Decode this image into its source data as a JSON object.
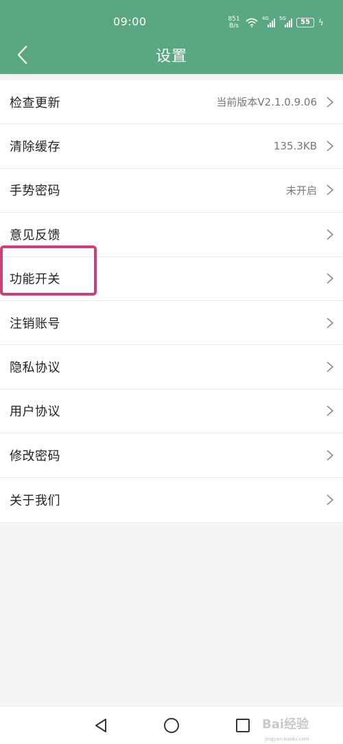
{
  "status_bar": {
    "time": "09:00",
    "speed_value": "851",
    "speed_unit": "B/s",
    "net1": "4G",
    "net2": "5G",
    "battery": "55"
  },
  "header": {
    "title": "设置",
    "back_icon": "chevron-left-icon"
  },
  "settings": [
    {
      "label": "检查更新",
      "value": "当前版本V2.1.0.9.06"
    },
    {
      "label": "清除缓存",
      "value": "135.3KB"
    },
    {
      "label": "手势密码",
      "value": "未开启"
    },
    {
      "label": "意见反馈",
      "value": ""
    },
    {
      "label": "功能开关",
      "value": ""
    },
    {
      "label": "注销账号",
      "value": ""
    },
    {
      "label": "隐私协议",
      "value": ""
    },
    {
      "label": "用户协议",
      "value": ""
    },
    {
      "label": "修改密码",
      "value": ""
    },
    {
      "label": "关于我们",
      "value": ""
    }
  ],
  "colors": {
    "header": "#5aa882",
    "highlight": "#d23a78"
  },
  "watermark": {
    "brand": "Bai经验",
    "url": "jingyan.baidu.com"
  }
}
